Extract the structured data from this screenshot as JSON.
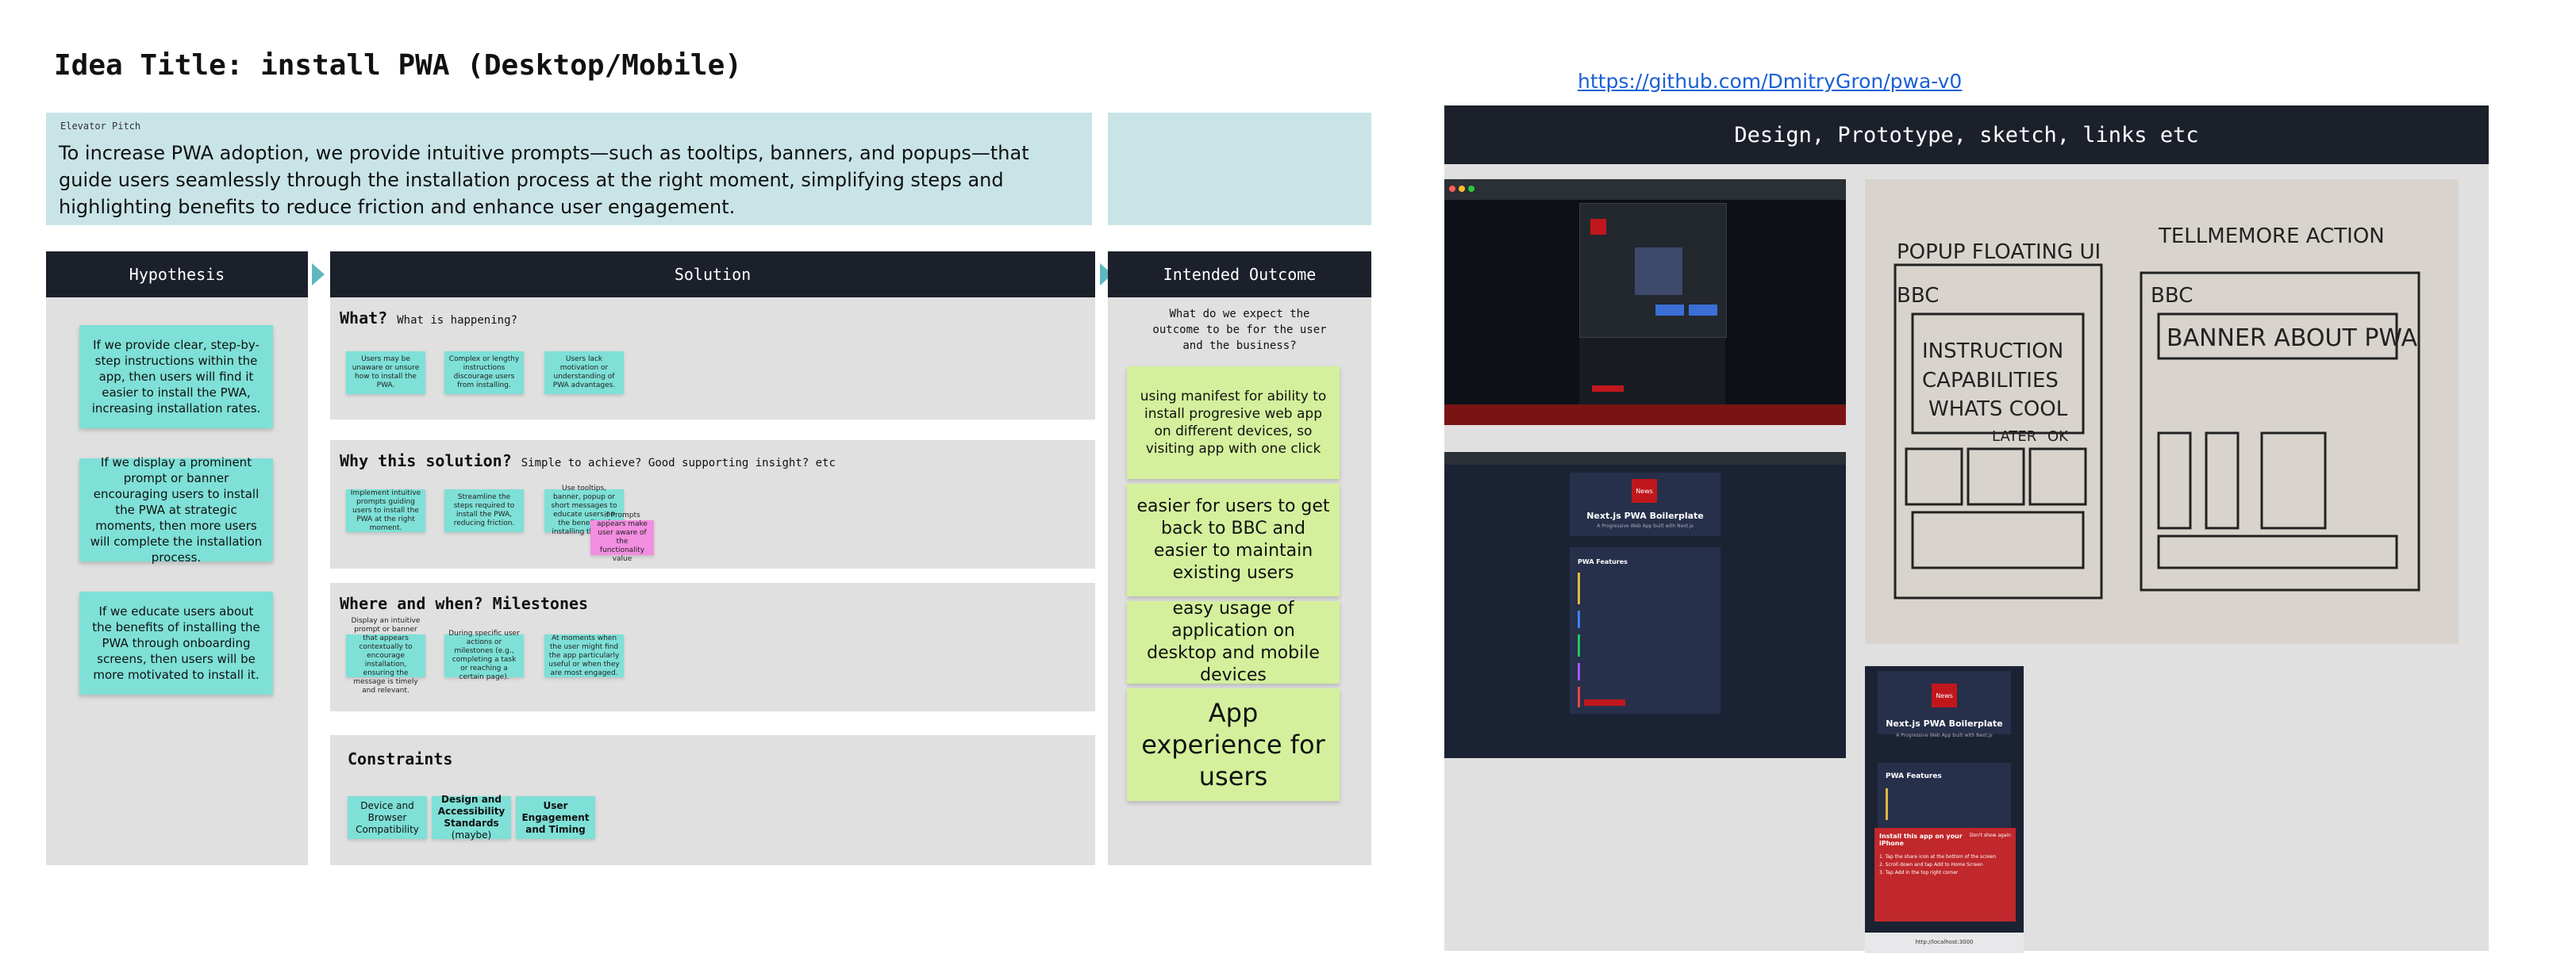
{
  "idea_title": "Idea Title: install PWA (Desktop/Mobile)",
  "elevator_pitch": {
    "label": "Elevator Pitch",
    "text": "To increase PWA adoption, we provide intuitive prompts—such as tooltips, banners, and popups—that guide users seamlessly through the installation process at the right moment, simplifying steps and highlighting benefits to reduce friction and enhance user engagement."
  },
  "columns": {
    "hypothesis": "Hypothesis",
    "solution": "Solution",
    "outcome": "Intended Outcome"
  },
  "hypotheses": [
    "If we provide clear, step-by-step instructions within the app, then users will find it easier to install the PWA, increasing installation rates.",
    "If we display a prominent prompt or banner encouraging users to install the PWA at strategic moments, then more users will complete the installation process.",
    "If we educate users about the benefits of installing the PWA through onboarding screens, then users will be more motivated to install it."
  ],
  "solution": {
    "what": {
      "title": "What?",
      "subtitle": "What is happening?",
      "notes": [
        "Users may be unaware or unsure how to install the PWA.",
        "Complex or lengthy instructions discourage users from installing.",
        "Users lack motivation or understanding of PWA advantages."
      ]
    },
    "why": {
      "title": "Why this solution?",
      "subtitle": "Simple to achieve? Good supporting insight? etc",
      "notes": [
        "Implement intuitive prompts guiding users to install the PWA at the right moment.",
        "Streamline the steps required to install the PWA, reducing friction.",
        "Use tooltips, banner, popup or short messages to educate users on the benefits of installing the PWA"
      ],
      "pink_note": "if Prompts appears make user aware of the functionality value"
    },
    "milestones": {
      "title": "Where and when? Milestones",
      "notes": [
        "Display an intuitive prompt or banner that appears contextually to encourage installation, ensuring the message is timely and relevant.",
        "During specific user actions or milestones (e.g., completing a task or reaching a certain page).",
        "At moments when the user might find the app particularly useful or when they are most engaged."
      ]
    },
    "constraints": {
      "title": "Constraints",
      "items": [
        {
          "text": "Device and Browser Compatibility",
          "bold": "",
          "suffix": ""
        },
        {
          "text": "",
          "bold": "Design and Accessibility Standards",
          "suffix": " (maybe)"
        },
        {
          "text": "",
          "bold": "User Engagement and Timing",
          "suffix": ""
        }
      ]
    }
  },
  "outcome": {
    "question": "What do we expect the outcome to be for the user and the business?",
    "notes": [
      "using  manifest for ability to install progresive web app on different devices, so visiting app with one click",
      "easier for users to get back to BBC and easier to maintain existing users",
      "easy usage of application on desktop and mobile devices",
      "App experience for users"
    ]
  },
  "design": {
    "link": "https://github.com/DmitryGron/pwa-v0",
    "header": "Design, Prototype, sketch, links etc",
    "boilerplate_title": "Next.js PWA Boilerplate",
    "boilerplate_sub": "A Progressive Web App built with Next.js",
    "news_badge": "News",
    "features_title": "PWA Features",
    "ios_banner_title": "Install this app on your iPhone",
    "ios_banner_dismiss": "Don't show again",
    "ios_steps": [
      "1. Tap the share icon at the bottom of the screen",
      "2. Scroll down and tap Add to Home Screen",
      "3. Tap Add in the top right corner"
    ],
    "ios_url": "http://localhost:3000",
    "sketch_left_title": "POPUP FLOATING UI",
    "sketch_right_title": "TELLMEMORE ACTION",
    "sketch_words": [
      "BBC",
      "INSTRUCTION",
      "CAPABILITIES",
      "WHATS COOL",
      "LATER",
      "OK",
      "BBC",
      "BANNER ABOUT PWA"
    ]
  }
}
